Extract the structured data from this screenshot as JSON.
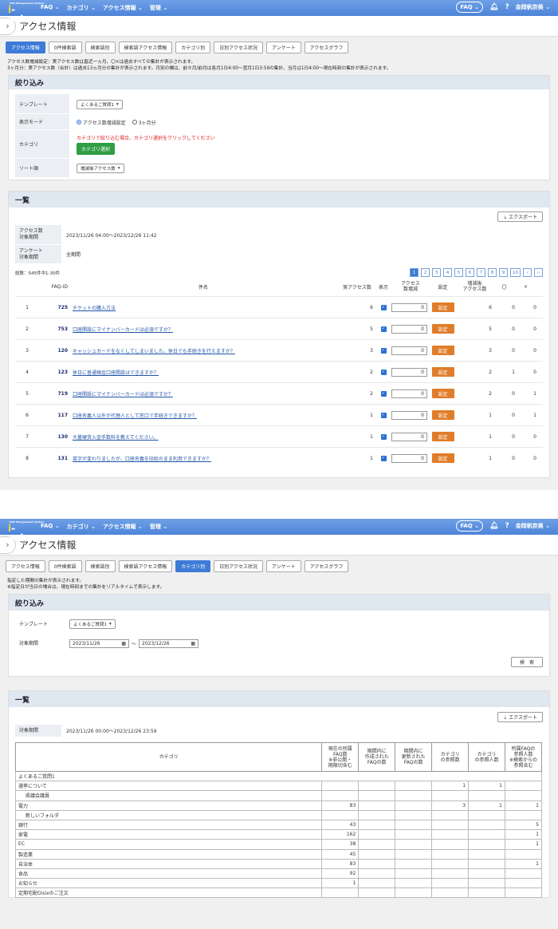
{
  "nav": {
    "logo_tiny": "FAQ Management System",
    "logo_text_i": "i",
    "logo_text_rest": "-ask",
    "menu": [
      "FAQ ⌄",
      "カテゴリ ⌄",
      "アクセス情報 ⌄",
      "管理 ⌄"
    ],
    "faq_pill": "FAQ ⌄",
    "user": "金岡帆奈美 ⌄"
  },
  "page_title": "アクセス情報",
  "tabs": [
    "アクセス情報",
    "0件検索語",
    "検索語別",
    "検索語アクセス情報",
    "カテゴリ別",
    "日別アクセス状況",
    "アンケート",
    "アクセスグラフ"
  ],
  "screen1": {
    "note_line1": "アクセス数増減設定：実アクセス数は直近一ヵ月、〇×は過去すべての集計が表示されます。",
    "note_line2": "3ヶ月分：実アクセス数（合計）は過去13ヵ月分の集計が表示されます。月別の欄は、前々月/前月は各月1日4:00〜翌月1日3:59の集計、当月は1日4:00〜現在時刻の集計が表示されます。",
    "filter": {
      "heading": "絞り込み",
      "template_label": "テンプレート",
      "template_value": "よくあるご質問1",
      "mode_label": "表示モード",
      "mode_option1": "アクセス数増減設定",
      "mode_option2": "3ヶ月分",
      "category_label": "カテゴリ",
      "category_hint": "カテゴリで絞り込む場合、カテゴリ選択をクリックしてください",
      "category_button": "カテゴリ選択",
      "sort_label": "ソート順",
      "sort_value": "増減後アクセス数"
    },
    "list": {
      "heading": "一覧",
      "export": "⇣ エクスポート",
      "period_label": "アクセス数\n対象期間",
      "period_value": "2023/11/26 04:00〜2023/12/26 11:42",
      "survey_label": "アンケート\n対象期間",
      "survey_value": "全期間",
      "total": "総数：545件中1-30件",
      "pages": [
        "1",
        "2",
        "3",
        "4",
        "5",
        "6",
        "7",
        "8",
        "9",
        "10",
        "›",
        "››"
      ],
      "headers": {
        "id": "FAQ-ID",
        "title": "件名",
        "count": "実アクセス数",
        "show": "表示",
        "adjust": "アクセス\n数増減",
        "set": "設定",
        "after": "増減後\nアクセス数",
        "o": "〇",
        "x": "×"
      },
      "set_label": "設定",
      "rows": [
        {
          "n": "1",
          "id": "725",
          "title": "チケットの購入方法",
          "count": "6",
          "adj": "0",
          "after": "6",
          "o": "0",
          "x": "0"
        },
        {
          "n": "2",
          "id": "753",
          "title": "口座開設にマイナンバーカードは必須ですか？",
          "count": "5",
          "adj": "0",
          "after": "5",
          "o": "0",
          "x": "0"
        },
        {
          "n": "3",
          "id": "120",
          "title": "キャッシュカードをなくしてしまいました。休日でも手続きを行えますか？",
          "count": "3",
          "adj": "0",
          "after": "3",
          "o": "0",
          "x": "0"
        },
        {
          "n": "4",
          "id": "123",
          "title": "休日に普通預金口座開設はできますか？",
          "count": "2",
          "adj": "0",
          "after": "2",
          "o": "1",
          "x": "0"
        },
        {
          "n": "5",
          "id": "719",
          "title": "口座開設にマイナンバーカードは必須ですか？",
          "count": "2",
          "adj": "0",
          "after": "2",
          "o": "0",
          "x": "1"
        },
        {
          "n": "6",
          "id": "117",
          "title": "口座名義人以外が代理人として窓口で手続きできますか？",
          "count": "1",
          "adj": "0",
          "after": "1",
          "o": "0",
          "x": "1"
        },
        {
          "n": "7",
          "id": "130",
          "title": "大量硬貨入金手数料を教えてください。",
          "count": "1",
          "adj": "0",
          "after": "1",
          "o": "0",
          "x": "0"
        },
        {
          "n": "8",
          "id": "131",
          "title": "苗字が変わりましたが、口座名義を旧姓のまま利用できますか？",
          "count": "1",
          "adj": "0",
          "after": "1",
          "o": "0",
          "x": "0"
        }
      ]
    }
  },
  "screen2": {
    "note_line1": "指定した期間の集計が表示されます。",
    "note_line2": "※指定日が当日の場合は、現在時刻までの集計をリアルタイムで表示します。",
    "filter": {
      "heading": "絞り込み",
      "template_label": "テンプレート",
      "template_value": "よくあるご質問1",
      "period_label": "対象期間",
      "date_from": "2023/11/26",
      "date_sep": "〜",
      "date_to": "2023/12/26",
      "search": "検　索"
    },
    "list": {
      "heading": "一覧",
      "export": "⇣ エクスポート",
      "period_label": "対象期間",
      "period_value": "2023/11/26 00:00〜2023/12/26 23:59",
      "headers": [
        "カテゴリ",
        "現在の所属\nFAQ数\n※非公開・\n期限切含む",
        "期間内に\n作成された\nFAQの数",
        "期間内に\n更新された\nFAQの数",
        "カテゴリ\nの参照数",
        "カテゴリ\nの参照人数",
        "所属FAQの\n参照人数\n※検索からの\n参照含む"
      ],
      "template_row": "よくあるご質問1",
      "rows": [
        {
          "name": "選挙について",
          "sub": false,
          "c1": "",
          "c2": "",
          "c3": "",
          "c4": "1",
          "c5": "1",
          "c6": ""
        },
        {
          "name": "県議会議員",
          "sub": true,
          "c1": "",
          "c2": "",
          "c3": "",
          "c4": "",
          "c5": "",
          "c6": ""
        },
        {
          "name": "電力",
          "sub": false,
          "c1": "83",
          "c2": "",
          "c3": "",
          "c4": "3",
          "c5": "1",
          "c6": "1"
        },
        {
          "name": "新しいフォルダ",
          "sub": true,
          "c1": "",
          "c2": "",
          "c3": "",
          "c4": "",
          "c5": "",
          "c6": ""
        },
        {
          "name": "銀行",
          "sub": false,
          "c1": "43",
          "c2": "",
          "c3": "",
          "c4": "",
          "c5": "",
          "c6": "5"
        },
        {
          "name": "家電",
          "sub": false,
          "c1": "162",
          "c2": "",
          "c3": "",
          "c4": "",
          "c5": "",
          "c6": "1"
        },
        {
          "name": "EC",
          "sub": false,
          "c1": "38",
          "c2": "",
          "c3": "",
          "c4": "",
          "c5": "",
          "c6": "1"
        },
        {
          "name": "製造業",
          "sub": false,
          "c1": "45",
          "c2": "",
          "c3": "",
          "c4": "",
          "c5": "",
          "c6": ""
        },
        {
          "name": "自治体",
          "sub": false,
          "c1": "83",
          "c2": "",
          "c3": "",
          "c4": "",
          "c5": "",
          "c6": "1"
        },
        {
          "name": "食品",
          "sub": false,
          "c1": "92",
          "c2": "",
          "c3": "",
          "c4": "",
          "c5": "",
          "c6": ""
        },
        {
          "name": "お知らせ",
          "sub": false,
          "c1": "1",
          "c2": "",
          "c3": "",
          "c4": "",
          "c5": "",
          "c6": ""
        },
        {
          "name": "定期宅配Oisixのご注文",
          "sub": false,
          "c1": "",
          "c2": "",
          "c3": "",
          "c4": "",
          "c5": "",
          "c6": ""
        }
      ]
    }
  }
}
